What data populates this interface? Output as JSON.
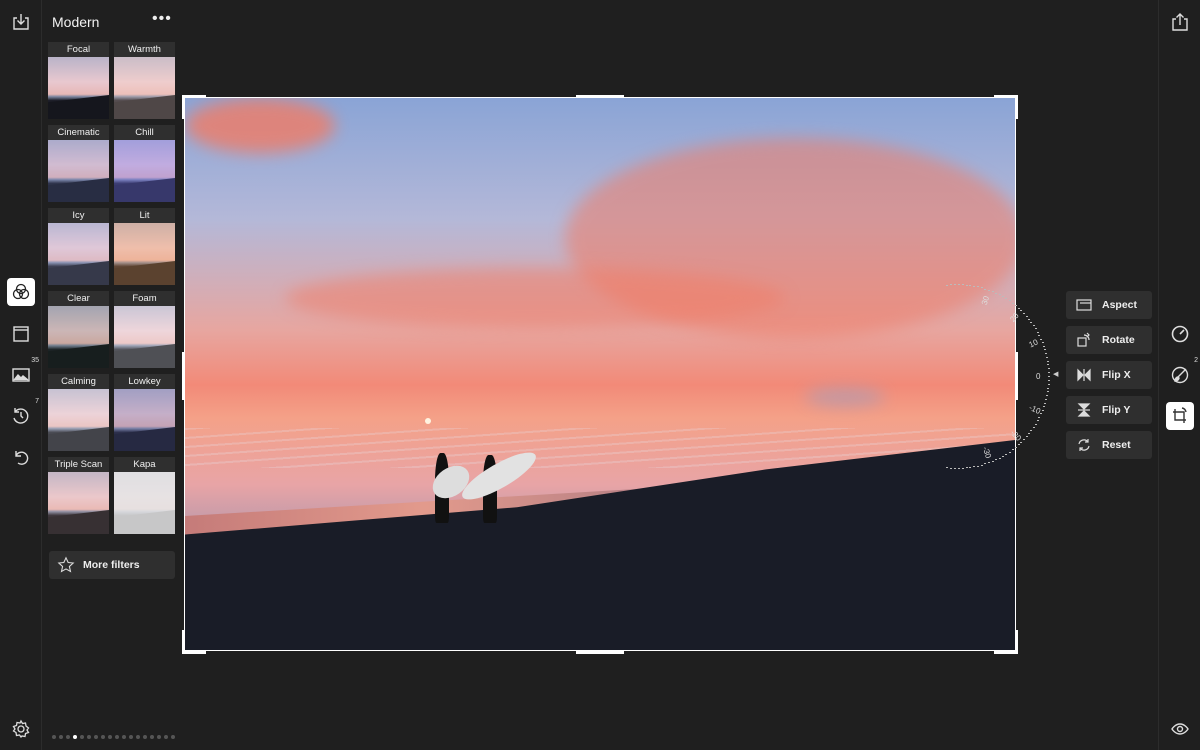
{
  "panel": {
    "title": "Modern",
    "more_label": "•••",
    "filters": [
      {
        "label": "Focal",
        "tint": "rgba(255,255,255,0)"
      },
      {
        "label": "Warmth",
        "tint": "rgba(255,220,200,.25)"
      },
      {
        "label": "Cinematic",
        "tint": "rgba(120,140,220,.2)"
      },
      {
        "label": "Chill",
        "tint": "rgba(120,120,255,.35)"
      },
      {
        "label": "Icy",
        "tint": "rgba(190,200,255,.2)"
      },
      {
        "label": "Lit",
        "tint": "rgba(255,170,90,.3)"
      },
      {
        "label": "Clear",
        "tint": "rgba(40,80,40,.15)"
      },
      {
        "label": "Foam",
        "tint": "rgba(255,255,255,.25)"
      },
      {
        "label": "Calming",
        "tint": "rgba(255,255,255,.2)"
      },
      {
        "label": "Lowkey",
        "tint": "rgba(90,100,180,.25)"
      },
      {
        "label": "Triple Scan",
        "tint": "rgba(255,200,180,.15)"
      },
      {
        "label": "Kapa",
        "tint": "rgba(230,230,230,.85)"
      }
    ],
    "more_filters": "More filters",
    "page_dots": 18,
    "active_dot": 4
  },
  "left_toolbar": {
    "items": [
      {
        "icon": "import-icon"
      },
      {
        "icon": "filters-icon",
        "active": true
      },
      {
        "icon": "frame-icon"
      },
      {
        "icon": "image-icon",
        "badge": "35"
      },
      {
        "icon": "history-icon",
        "badge": "7"
      },
      {
        "icon": "undo-icon"
      },
      {
        "icon": "settings-icon"
      }
    ]
  },
  "right_toolbar": {
    "items": [
      {
        "icon": "share-icon"
      },
      {
        "icon": "adjust-dial-icon"
      },
      {
        "icon": "brush-icon",
        "badge": "2"
      },
      {
        "icon": "crop-rotate-icon",
        "active": true
      },
      {
        "icon": "eye-icon"
      }
    ]
  },
  "crop_tools": [
    {
      "label": "Aspect",
      "icon": "aspect-icon"
    },
    {
      "label": "Rotate",
      "icon": "rotate-icon"
    },
    {
      "label": "Flip X",
      "icon": "flip-x-icon"
    },
    {
      "label": "Flip Y",
      "icon": "flip-y-icon"
    },
    {
      "label": "Reset",
      "icon": "reset-icon"
    }
  ],
  "rotation_dial": {
    "labels": [
      "30",
      "20",
      "10",
      "0",
      "-10",
      "-20",
      "-30"
    ],
    "value": 0
  }
}
